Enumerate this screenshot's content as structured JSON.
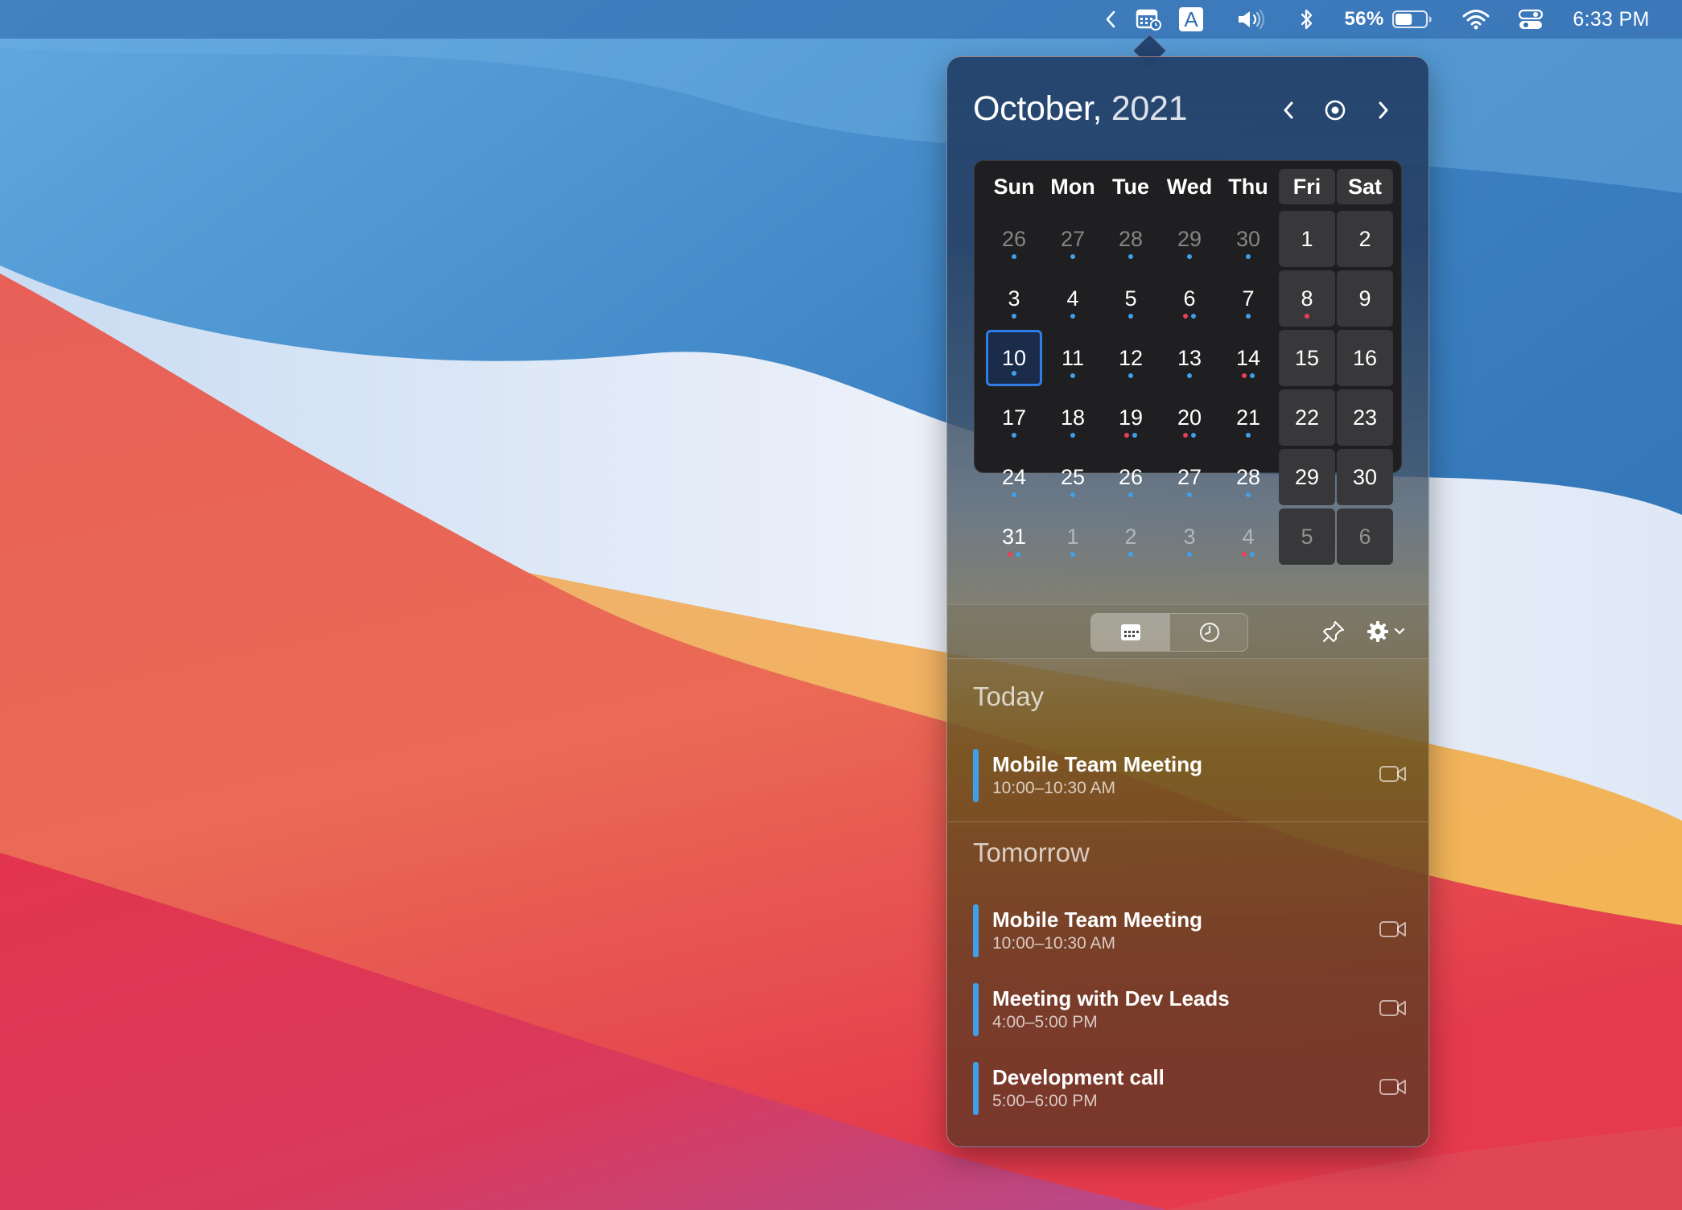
{
  "menubar": {
    "battery_percent": "56%",
    "battery_level": 0.56,
    "clock": "6:33 PM",
    "input_source": "A",
    "icons": [
      "chevron-left-icon",
      "calendar-app-icon",
      "input-source-icon",
      "volume-icon",
      "bluetooth-icon",
      "battery-icon",
      "wifi-icon",
      "control-center-icon"
    ]
  },
  "calendar": {
    "month": "October,",
    "year": "2021",
    "weekdays": [
      "Sun",
      "Mon",
      "Tue",
      "Wed",
      "Thu",
      "Fri",
      "Sat"
    ],
    "weeks": [
      [
        "26",
        "27",
        "28",
        "29",
        "30",
        "1",
        "2"
      ],
      [
        "3",
        "4",
        "5",
        "6",
        "7",
        "8",
        "9"
      ],
      [
        "10",
        "11",
        "12",
        "13",
        "14",
        "15",
        "16"
      ],
      [
        "17",
        "18",
        "19",
        "20",
        "21",
        "22",
        "23"
      ],
      [
        "24",
        "25",
        "26",
        "27",
        "28",
        "29",
        "30"
      ],
      [
        "31",
        "1",
        "2",
        "3",
        "4",
        "5",
        "6"
      ]
    ],
    "colors": {
      "blue_dot": "#3fa0ea",
      "red_dot": "#e8405a",
      "today_border": "#2f7ee8"
    }
  },
  "toolbar": {
    "icons": [
      "calendar-view-icon",
      "clock-view-icon",
      "pin-icon",
      "gear-icon",
      "chevron-down-icon"
    ]
  },
  "events": {
    "today_label": "Today",
    "tomorrow_label": "Tomorrow",
    "today": [
      {
        "title": "Mobile Team Meeting",
        "time": "10:00–10:30 AM"
      }
    ],
    "tomorrow": [
      {
        "title": "Mobile Team Meeting",
        "time": "10:00–10:30 AM"
      },
      {
        "title": "Meeting with Dev Leads",
        "time": "4:00–5:00 PM"
      },
      {
        "title": "Development call",
        "time": "5:00–6:00 PM"
      }
    ]
  }
}
